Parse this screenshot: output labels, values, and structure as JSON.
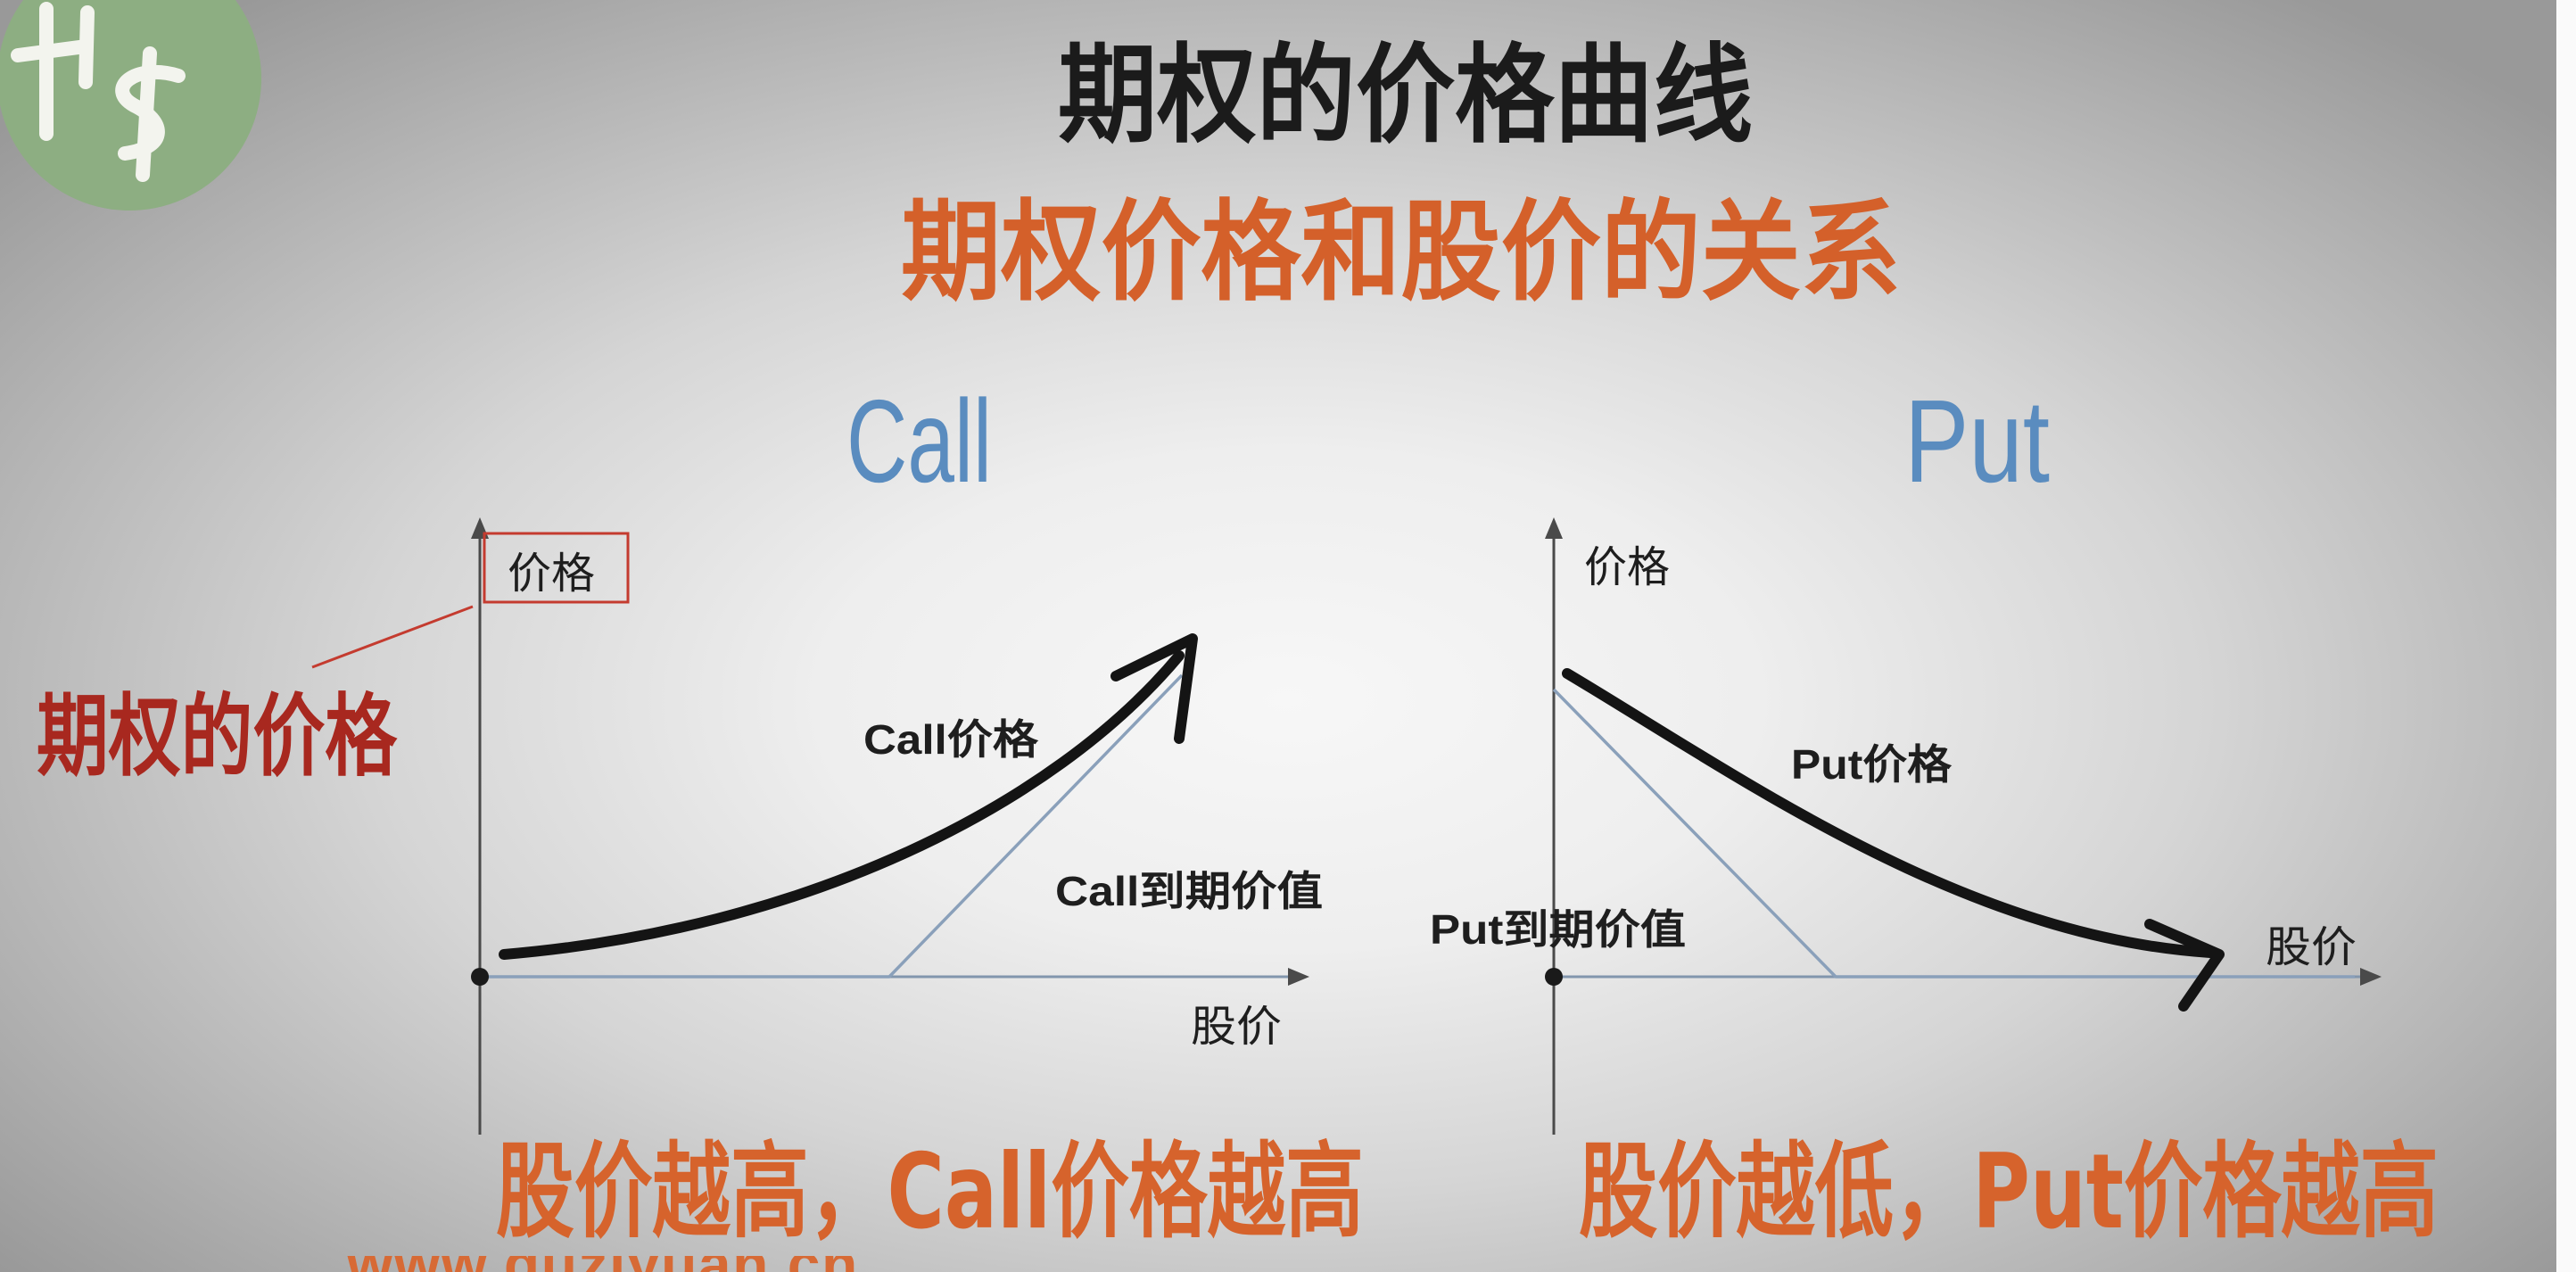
{
  "title": "期权的价格曲线",
  "subtitle": "期权价格和股价的关系",
  "colors": {
    "title": "#1b1b1b",
    "subtitle": "#d4602a",
    "heading": "#5a8cbf",
    "callout": "#a8281f",
    "callout_box": "#c43b2f",
    "conclusion": "#d6632c",
    "watermark": "#d76a35",
    "price_curve": "#141414",
    "y_axis": "#4a4a4a",
    "x_axis": "#8296ad",
    "expiry_line": "#8aa0ba",
    "origin_dot": "#1a1a1a",
    "logo": "#8dae82",
    "logo_mark": "#f3f4ee",
    "edge_strip": "#fafafa"
  },
  "charts": {
    "call": {
      "heading": "Call",
      "y_axis_label": "价格",
      "y_axis_callout": "期权的价格",
      "x_axis_label": "股价",
      "price_curve_label": "Call价格",
      "expiry_value_label": "Call到期价值",
      "conclusion": "股价越高，Call价格越高"
    },
    "put": {
      "heading": "Put",
      "y_axis_label": "价格",
      "x_axis_label": "股价",
      "price_curve_label": "Put价格",
      "expiry_value_label": "Put到期价值",
      "conclusion": "股价越低，Put价格越高"
    }
  },
  "watermark": "www.guziyuan.cn"
}
